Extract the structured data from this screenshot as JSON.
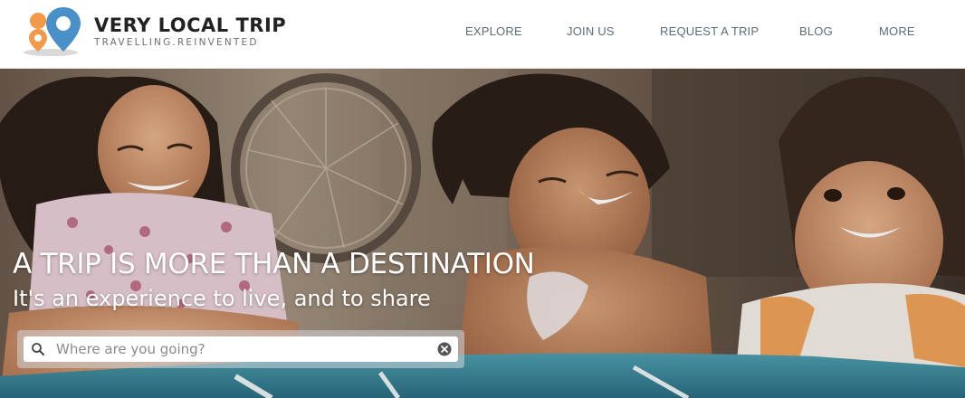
{
  "brand": {
    "name": "VERY LOCAL TRIP",
    "tagline": "TRAVELLING.REINVENTED"
  },
  "nav": {
    "items": [
      {
        "label": "EXPLORE"
      },
      {
        "label": "JOIN US"
      },
      {
        "label": "REQUEST A TRIP"
      },
      {
        "label": "BLOG"
      },
      {
        "label": "MORE"
      }
    ]
  },
  "hero": {
    "headline": "A TRIP IS MORE THAN A DESTINATION",
    "subheadline": "It's an experience to live, and to share",
    "image": "photo of three laughing children at a table"
  },
  "search": {
    "placeholder": "Where are you going?",
    "value": "",
    "icon": "search-icon",
    "clear_icon": "clear-icon"
  },
  "colors": {
    "pin_orange": "#f2994a",
    "pin_blue": "#4a90c8",
    "nav_text": "#5e6b78",
    "brand_text": "#222222"
  }
}
